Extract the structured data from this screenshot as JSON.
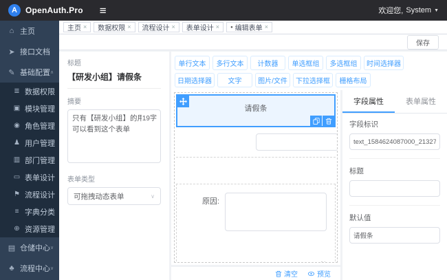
{
  "topbar": {
    "logo_letter": "A",
    "brand": "OpenAuth.Pro",
    "hamburger_glyph": "≡",
    "welcome": "欢迎您,",
    "user": "System",
    "caret_glyph": "▼"
  },
  "tabs": {
    "dot_glyph": "●",
    "close_glyph": "×",
    "items": [
      "主页",
      "数据权限",
      "流程设计",
      "表单设计",
      "编辑表单"
    ]
  },
  "toolbar": {
    "save": "保存"
  },
  "sidebar": {
    "items": [
      {
        "glyph": "⌂",
        "label": "主页"
      },
      {
        "glyph": "➤",
        "label": "接口文档"
      },
      {
        "glyph": "✎",
        "label": "基础配置",
        "caret": "∧"
      },
      {
        "glyph": "▤",
        "label": "仓储中心",
        "caret": "∨"
      },
      {
        "glyph": "♣",
        "label": "流程中心",
        "caret": "∨"
      }
    ],
    "submenu": [
      {
        "glyph": "≣",
        "label": "数据权限"
      },
      {
        "glyph": "▣",
        "label": "模块管理"
      },
      {
        "glyph": "◉",
        "label": "角色管理"
      },
      {
        "glyph": "♟",
        "label": "用户管理"
      },
      {
        "glyph": "▥",
        "label": "部门管理"
      },
      {
        "glyph": "▭",
        "label": "表单设计"
      },
      {
        "glyph": "⚑",
        "label": "流程设计"
      },
      {
        "glyph": "≡",
        "label": "字典分类"
      },
      {
        "glyph": "⊕",
        "label": "资源管理"
      }
    ]
  },
  "form_meta": {
    "title_label": "标题",
    "title_value": "【研发小组】请假条",
    "summary_label": "摘要",
    "summary_value": "只有【研发小组】的用户可以看到这个表单",
    "summary_count": "19字",
    "type_label": "表单类型",
    "type_value": "可拖拽动态表单"
  },
  "palette": {
    "row1": [
      "单行文本",
      "多行文本",
      "计数器",
      "单选框组",
      "多选框组",
      "时间选择器",
      "日期选择器"
    ],
    "row2": [
      "文字",
      "图片/文件",
      "下拉选择框",
      "栅格布局"
    ]
  },
  "canvas": {
    "field_text": "请假条",
    "reason_label": "原因:",
    "clear_label": "清空",
    "preview_label": "预览"
  },
  "props": {
    "tab_field": "字段属性",
    "tab_form": "表单属性",
    "field_id_label": "字段标识",
    "field_id_value": "text_1584624087000_21327",
    "title_label": "标题",
    "title_value": "",
    "default_label": "默认值",
    "default_value": "请假条"
  },
  "colors": {
    "accent": "#409eff",
    "topbar_bg": "#2a2a2e",
    "sidebar_bg": "#304156",
    "submenu_bg": "#1f2d3d",
    "content_bg": "#f0f2f5"
  }
}
